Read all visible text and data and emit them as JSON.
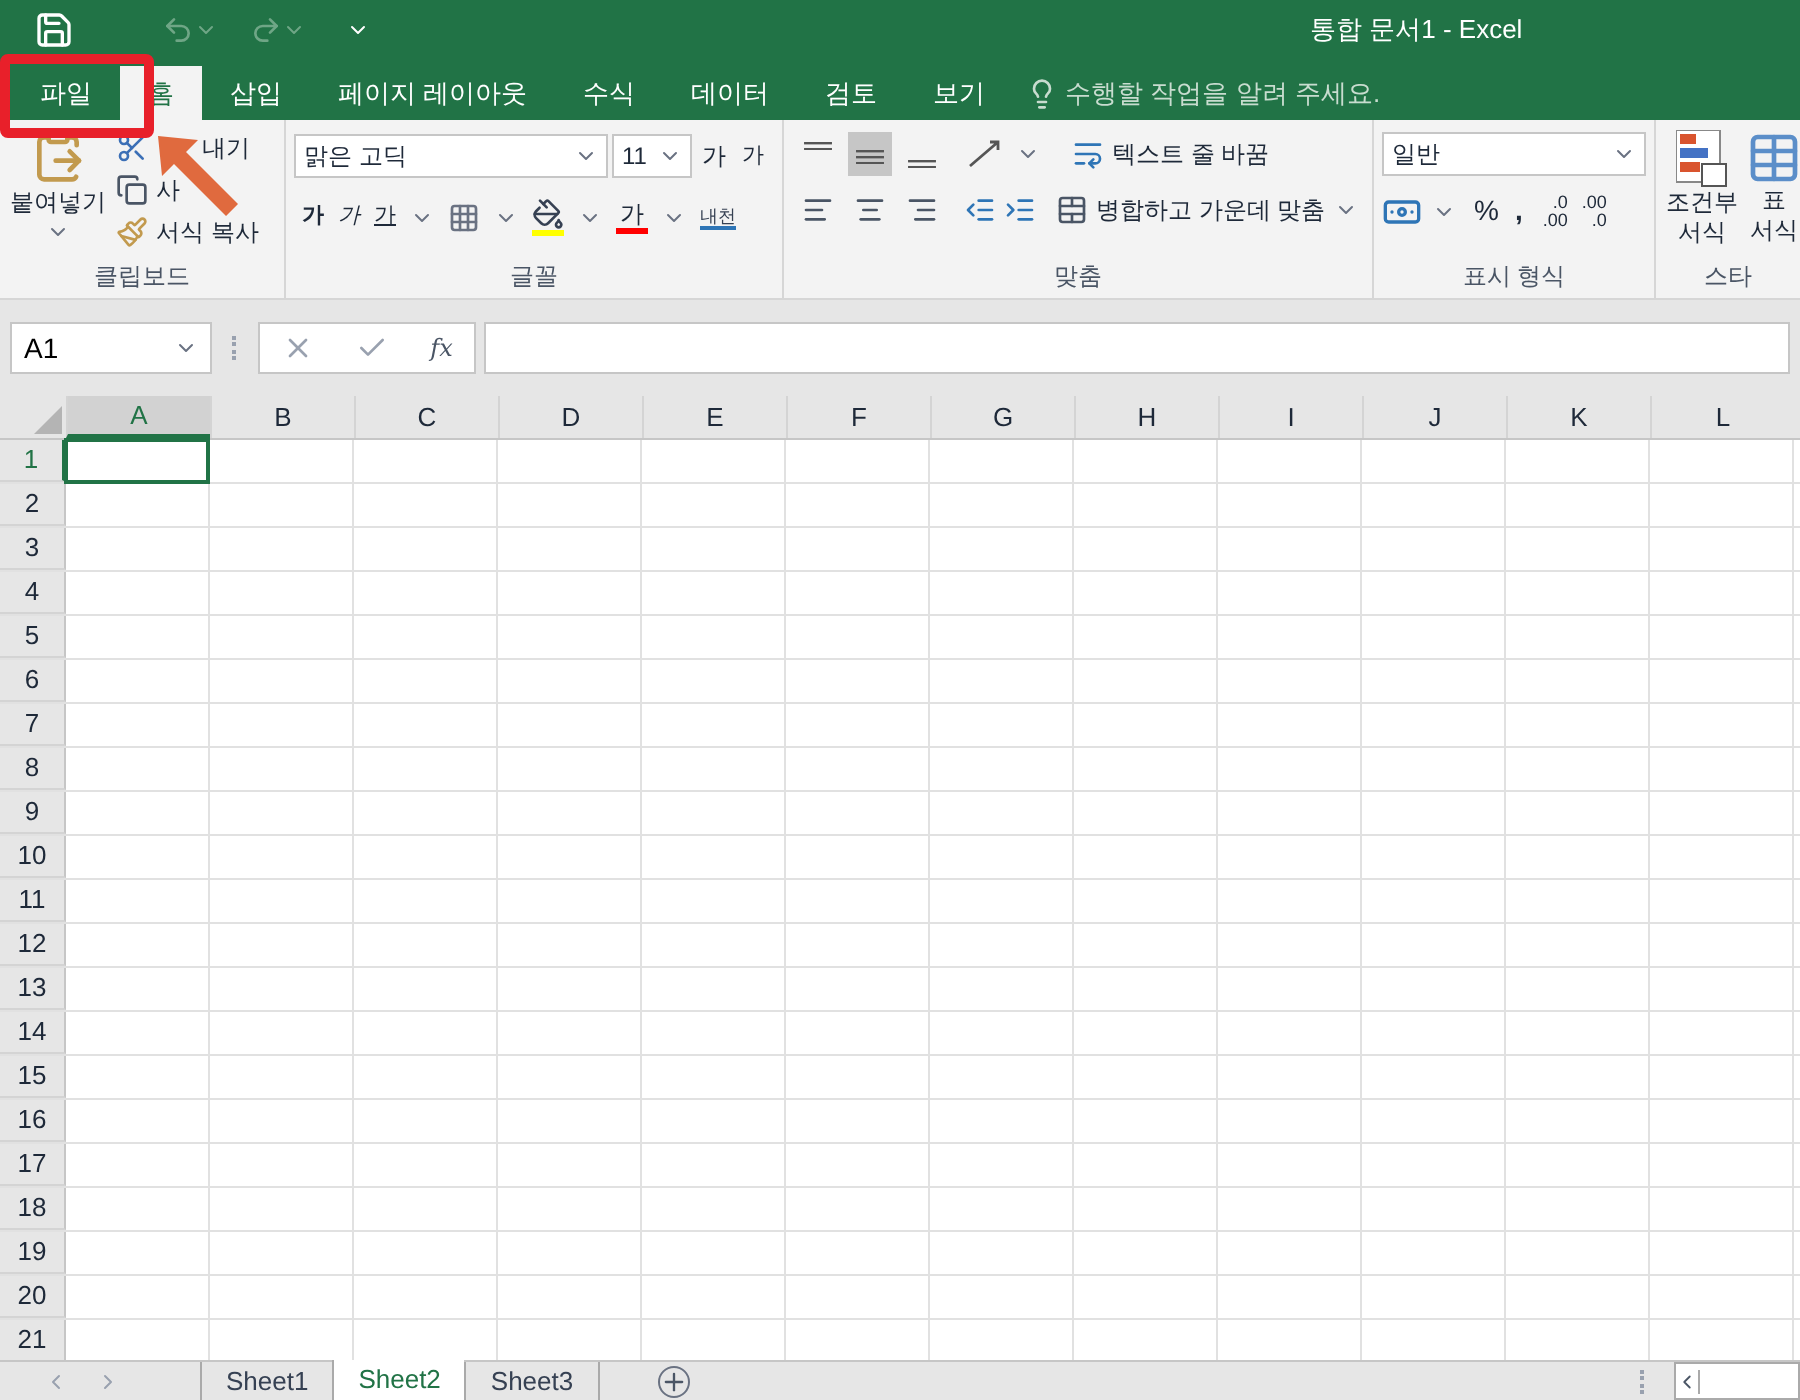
{
  "window": {
    "title": "통합 문서1 - Excel"
  },
  "tabs": [
    {
      "label": "파일",
      "selected": false
    },
    {
      "label": "홈",
      "selected": true
    },
    {
      "label": "삽입",
      "selected": false
    },
    {
      "label": "페이지 레이아웃",
      "selected": false
    },
    {
      "label": "수식",
      "selected": false
    },
    {
      "label": "데이터",
      "selected": false
    },
    {
      "label": "검토",
      "selected": false
    },
    {
      "label": "보기",
      "selected": false
    }
  ],
  "tell_me": {
    "placeholder": "수행할 작업을 알려 주세요."
  },
  "ribbon": {
    "clipboard": {
      "label": "클립보드",
      "paste": "붙여넣기",
      "cut": "내기",
      "copy": "사",
      "format_painter": "서식 복사"
    },
    "font": {
      "label": "글꼴",
      "font_name": "맑은 고딕",
      "font_size": "11",
      "grow": "가",
      "shrink": "가",
      "bold": "가",
      "italic": "가",
      "underline": "가",
      "font_color": "가",
      "phonetic": "내천"
    },
    "alignment": {
      "label": "맞춤",
      "vertical": [
        {
          "kind": "top",
          "selected": false
        },
        {
          "kind": "middle",
          "selected": true
        },
        {
          "kind": "bottom",
          "selected": false
        }
      ],
      "horizontal": [
        {
          "kind": "left",
          "selected": false
        },
        {
          "kind": "center",
          "selected": false
        },
        {
          "kind": "right",
          "selected": false
        }
      ],
      "wrap_text": "텍스트 줄 바꿈",
      "merge": "병합하고 가운데 맞춤"
    },
    "number": {
      "label": "표시 형식",
      "format": "일반",
      "percent": "%",
      "comma": ",",
      "decimals": [
        {
          "top": ".0",
          "bottom": ".00"
        },
        {
          "top": ".00",
          "bottom": ".0"
        }
      ]
    },
    "styles": {
      "label": "스타",
      "conditional": "조건부 서식",
      "table_format": "표 서식"
    }
  },
  "formula_bar": {
    "name_box": "A1",
    "fx": "fx"
  },
  "grid": {
    "columns": [
      {
        "label": "A",
        "selected": true
      },
      {
        "label": "B",
        "selected": false
      },
      {
        "label": "C",
        "selected": false
      },
      {
        "label": "D",
        "selected": false
      },
      {
        "label": "E",
        "selected": false
      },
      {
        "label": "F",
        "selected": false
      },
      {
        "label": "G",
        "selected": false
      },
      {
        "label": "H",
        "selected": false
      },
      {
        "label": "I",
        "selected": false
      },
      {
        "label": "J",
        "selected": false
      },
      {
        "label": "K",
        "selected": false
      },
      {
        "label": "L",
        "selected": false
      }
    ],
    "rows": [
      {
        "label": "1",
        "selected": true
      },
      {
        "label": "2",
        "selected": false
      },
      {
        "label": "3",
        "selected": false
      },
      {
        "label": "4",
        "selected": false
      },
      {
        "label": "5",
        "selected": false
      },
      {
        "label": "6",
        "selected": false
      },
      {
        "label": "7",
        "selected": false
      },
      {
        "label": "8",
        "selected": false
      },
      {
        "label": "9",
        "selected": false
      },
      {
        "label": "10",
        "selected": false
      },
      {
        "label": "11",
        "selected": false
      },
      {
        "label": "12",
        "selected": false
      },
      {
        "label": "13",
        "selected": false
      },
      {
        "label": "14",
        "selected": false
      },
      {
        "label": "15",
        "selected": false
      },
      {
        "label": "16",
        "selected": false
      },
      {
        "label": "17",
        "selected": false
      },
      {
        "label": "18",
        "selected": false
      },
      {
        "label": "19",
        "selected": false
      },
      {
        "label": "20",
        "selected": false
      },
      {
        "label": "21",
        "selected": false
      }
    ]
  },
  "sheets": [
    {
      "label": "Sheet1",
      "selected": false
    },
    {
      "label": "Sheet2",
      "selected": true
    },
    {
      "label": "Sheet3",
      "selected": false
    }
  ],
  "annotations": {
    "highlight_box": true,
    "arrow": true
  }
}
